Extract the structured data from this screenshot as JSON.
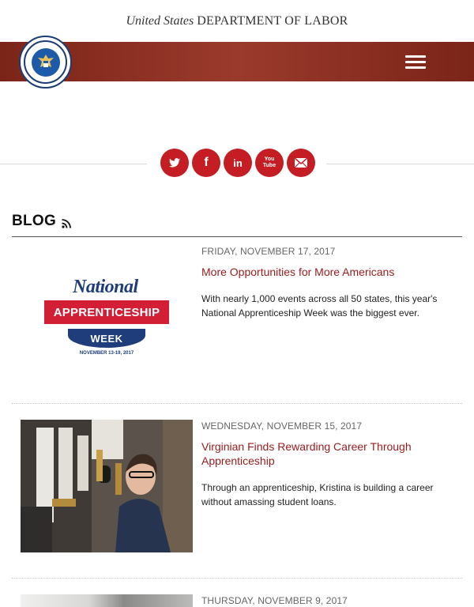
{
  "header": {
    "agency_prefix": "United States",
    "agency_name": "DEPARTMENT OF LABOR",
    "seal_label": "Department of Labor seal"
  },
  "nav": {
    "menu_icon": "hamburger-menu-icon"
  },
  "social": {
    "links": [
      {
        "name": "twitter",
        "icon": "twitter-icon"
      },
      {
        "name": "facebook",
        "icon": "facebook-icon",
        "glyph": "f"
      },
      {
        "name": "linkedin",
        "icon": "linkedin-icon",
        "glyph": "in"
      },
      {
        "name": "youtube",
        "icon": "youtube-icon",
        "glyph": "You Tube"
      },
      {
        "name": "email",
        "icon": "email-icon"
      }
    ],
    "color": "#c41d24"
  },
  "blog": {
    "heading": "BLOG",
    "feed_icon": "rss-icon",
    "posts": [
      {
        "date": "FRIDAY, NOVEMBER 17, 2017",
        "title": "More Opportunities for More Americans",
        "excerpt": "With nearly 1,000 events across all 50 states, this year's National Apprenticeship Week was the biggest ever.",
        "image": {
          "line1": "National",
          "line2": "APPRENTICESHIP",
          "line3": "WEEK",
          "line4": "NOVEMBER 13-19, 2017"
        }
      },
      {
        "date": "WEDNESDAY, NOVEMBER 15, 2017",
        "title": "Virginian Finds Rewarding Career Through Apprenticeship",
        "excerpt": "Through an apprenticeship, Kristina is building a career without amassing student loans."
      },
      {
        "date": "THURSDAY, NOVEMBER 9, 2017"
      }
    ]
  },
  "colors": {
    "brand_red": "#9a1b1e",
    "nav_bar": "#8c2f22",
    "seal_blue": "#1d5aa8"
  }
}
